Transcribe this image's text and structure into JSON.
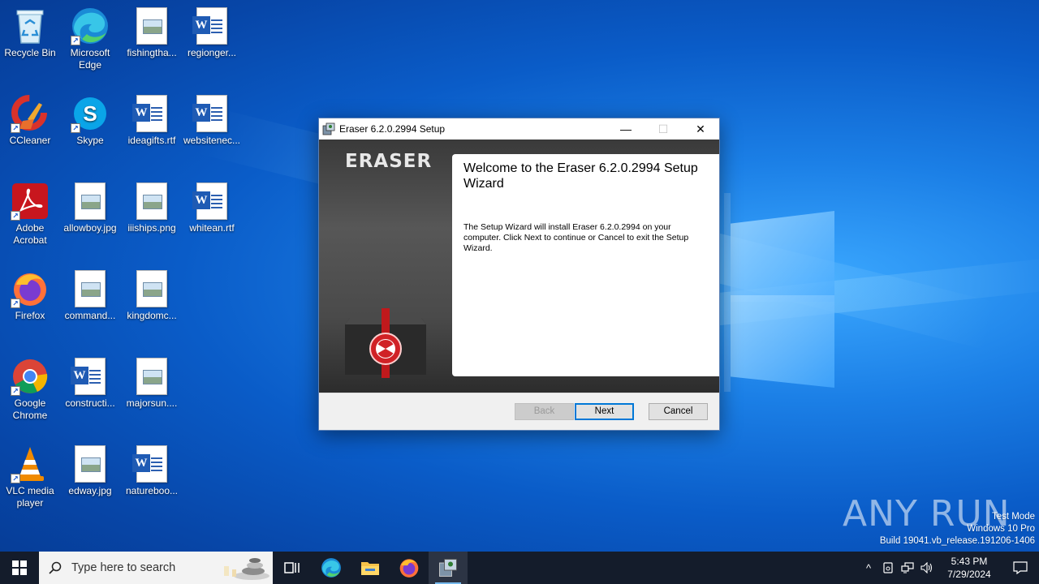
{
  "desktop": {
    "icons": [
      {
        "label": "Recycle Bin",
        "icon": "recycle-bin-icon"
      },
      {
        "label": "Microsoft Edge",
        "icon": "edge-icon"
      },
      {
        "label": "fishingtha...",
        "icon": "image-file-icon"
      },
      {
        "label": "regionger...",
        "icon": "word-document-icon"
      },
      {
        "label": "CCleaner",
        "icon": "ccleaner-icon"
      },
      {
        "label": "Skype",
        "icon": "skype-icon"
      },
      {
        "label": "ideagifts.rtf",
        "icon": "word-document-icon"
      },
      {
        "label": "websitenec...",
        "icon": "word-document-icon"
      },
      {
        "label": "Adobe Acrobat",
        "icon": "acrobat-icon"
      },
      {
        "label": "allowboy.jpg",
        "icon": "image-file-icon"
      },
      {
        "label": "iiiships.png",
        "icon": "image-file-icon"
      },
      {
        "label": "whitean.rtf",
        "icon": "word-document-icon"
      },
      {
        "label": "Firefox",
        "icon": "firefox-icon"
      },
      {
        "label": "command...",
        "icon": "image-file-icon"
      },
      {
        "label": "kingdomc...",
        "icon": "image-file-icon"
      },
      {
        "label": "Google Chrome",
        "icon": "chrome-icon"
      },
      {
        "label": "constructi...",
        "icon": "word-document-icon"
      },
      {
        "label": "majorsun....",
        "icon": "image-file-icon"
      },
      {
        "label": "VLC media player",
        "icon": "vlc-icon"
      },
      {
        "label": "edway.jpg",
        "icon": "image-file-icon"
      },
      {
        "label": "natureboo...",
        "icon": "word-document-icon"
      }
    ]
  },
  "installer": {
    "title": "Eraser 6.2.0.2994 Setup",
    "brand": "ERASER",
    "welcome_title": "Welcome to the Eraser 6.2.0.2994 Setup Wizard",
    "welcome_text": "The Setup Wizard will install Eraser 6.2.0.2994 on your computer. Click Next to continue or Cancel to exit the Setup Wizard.",
    "buttons": {
      "back": "Back",
      "next": "Next",
      "cancel": "Cancel"
    },
    "controls": {
      "minimize": "—",
      "maximize": "☐",
      "close": "✕"
    }
  },
  "watermark": {
    "brand": "ANY RUN",
    "line1": "Test Mode",
    "line2": "Windows 10 Pro",
    "line3": "Build 19041.vb_release.191206-1406"
  },
  "taskbar": {
    "search_placeholder": "Type here to search",
    "apps": [
      "task-view-icon",
      "edge-icon",
      "file-explorer-icon",
      "firefox-icon",
      "eraser-setup-icon"
    ],
    "time": "5:43 PM",
    "date": "7/29/2024"
  }
}
